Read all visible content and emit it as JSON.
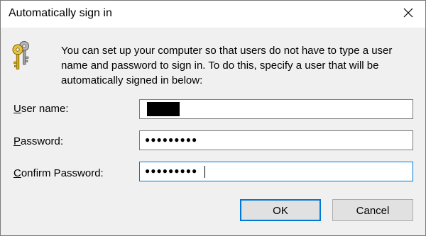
{
  "window": {
    "title": "Automatically sign in"
  },
  "icons": {
    "close": "close-icon",
    "keys": "keys-icon"
  },
  "message": "You can set up your computer so that users do not have to type a user name and password to sign in. To do this, specify a user that will be automatically signed in below:",
  "form": {
    "username": {
      "label_ul": "U",
      "label_rest": "ser name:",
      "value_redacted": true
    },
    "password": {
      "label_ul": "P",
      "label_rest": "assword:",
      "value": "●●●●●●●●●"
    },
    "confirm": {
      "label_ul": "C",
      "label_rest": "onfirm Password:",
      "value": "●●●●●●●●●"
    }
  },
  "buttons": {
    "ok": "OK",
    "cancel": "Cancel"
  },
  "colors": {
    "accent": "#0078d7",
    "dialog_bg": "#f0f0f0",
    "button_bg": "#e1e1e1"
  }
}
